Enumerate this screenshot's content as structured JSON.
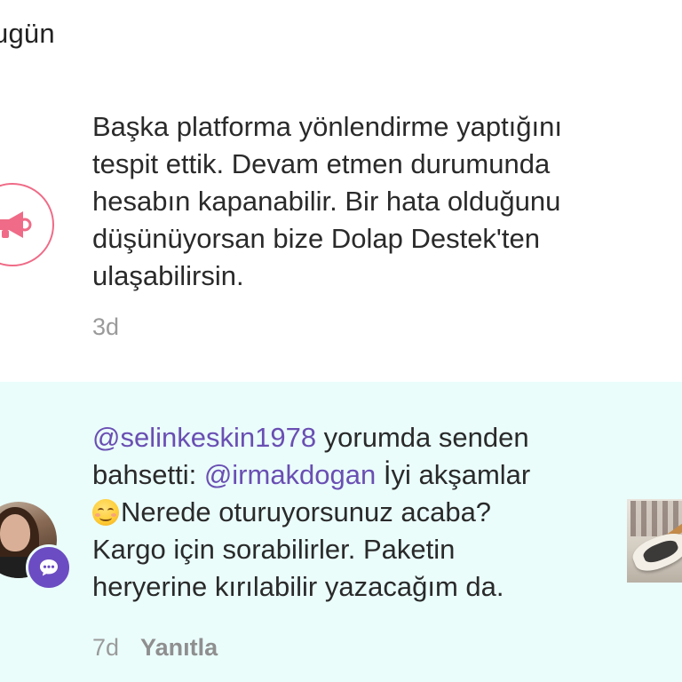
{
  "section": {
    "header": "ugün"
  },
  "notifications": [
    {
      "type": "system",
      "icon": "megaphone-icon",
      "message": "Başka platforma yönlendirme yaptığını\ntespit ettik. Devam etmen durumunda\nhesabın kapanabilir. Bir hata olduğunu\ndüşünüyorsan bize Dolap Destek'ten\nulaşabilirsin.",
      "time": "3d"
    },
    {
      "type": "comment-mention",
      "mention_user": "@selinkeskin1978",
      "text_1": " yorumda senden\nbahsetti: ",
      "mention_target": "@irmakdogan",
      "text_2": " İyi akşamlar\n",
      "emoji": "smiling-face-emoji",
      "text_3": "Nerede oturuyorsunuz acaba?\nKargo için sorabilirler. Paketin\nheryerine kırılabilir yazacağım da.",
      "time": "7d",
      "reply_label": "Yanıtla",
      "background": "#eafdfb"
    }
  ],
  "colors": {
    "accent_pink": "#ef6b87",
    "mention_purple": "#6a4fb3",
    "badge_purple": "#6c4cc2",
    "muted_text": "#9a9a9a"
  }
}
